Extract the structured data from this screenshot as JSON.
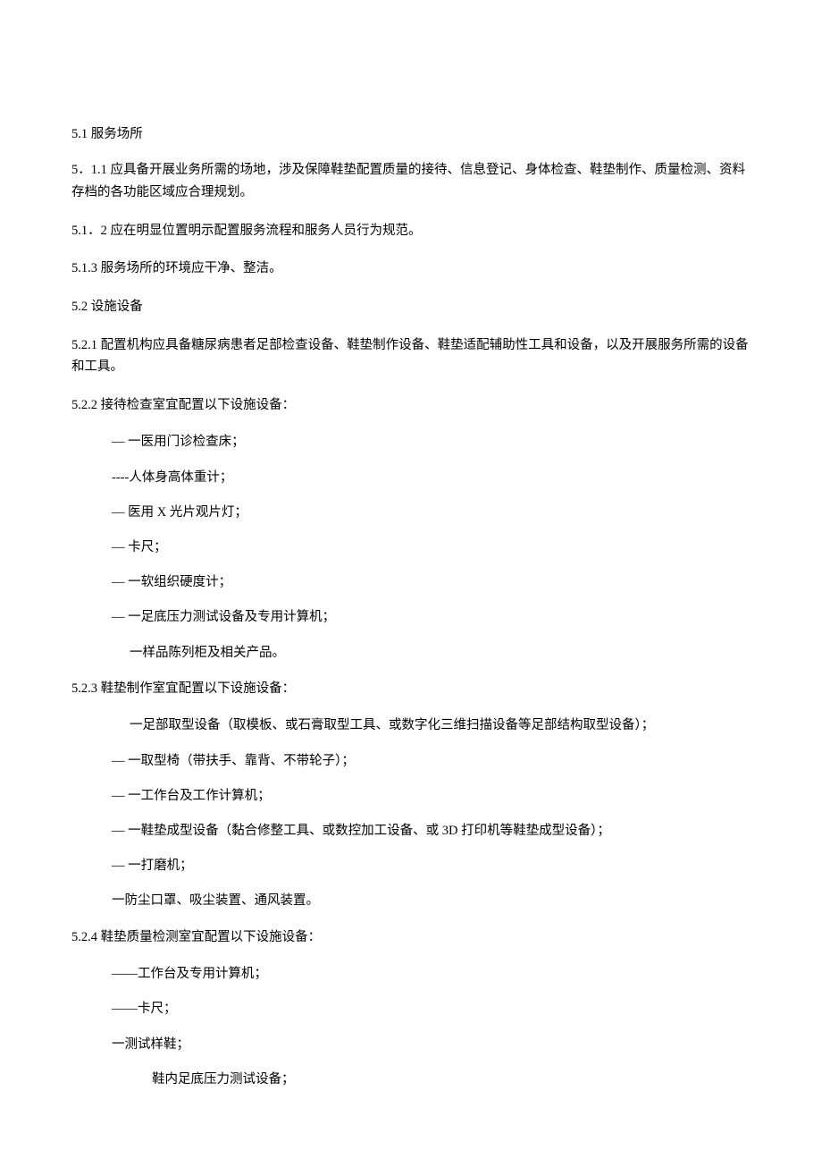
{
  "s51": {
    "heading": "5.1  服务场所",
    "p1": "5．1.1 应具备开展业务所需的场地，涉及保障鞋垫配置质量的接待、信息登记、身体检查、鞋垫制作、质量检测、资料存档的各功能区域应合理规划。",
    "p2": "5.1．2 应在明显位置明示配置服务流程和服务人员行为规范。",
    "p3": "5.1.3 服务场所的环境应干净、整洁。"
  },
  "s52": {
    "heading": "5.2 设施设备",
    "p1": "5.2.1 配置机构应具备糖尿病患者足部检查设备、鞋垫制作设备、鞋垫适配辅助性工具和设备，以及开展服务所需的设备和工具。",
    "s522": {
      "heading": "5.2.2 接待检查室宜配置以下设施设备：",
      "items": [
        "— 一医用门诊检查床；",
        "----人体身高体重计；",
        "—    医用 X 光片观片灯；",
        "—   卡尺；",
        "— 一软组织硬度计；",
        "— 一足底压力测试设备及专用计算机；",
        "一样品陈列柜及相关产品。"
      ]
    },
    "s523": {
      "heading": "5.2.3 鞋垫制作室宜配置以下设施设备：",
      "items": [
        "一足部取型设备（取模板、或石膏取型工具、或数字化三维扫描设备等足部结构取型设备）；",
        "— 一取型椅（带扶手、靠背、不带轮子）；",
        "— 一工作台及工作计算机；",
        "— 一鞋垫成型设备（黏合修整工具、或数控加工设备、或 3D 打印机等鞋垫成型设备）；",
        "— 一打磨机；",
        "一防尘口罩、吸尘装置、通风装置。"
      ]
    },
    "s524": {
      "heading": "5.2.4 鞋垫质量检测室宜配置以下设施设备：",
      "items": [
        "——工作台及专用计算机；",
        "——卡尺；",
        "一测试样鞋；",
        "鞋内足底压力测试设备；"
      ]
    }
  }
}
